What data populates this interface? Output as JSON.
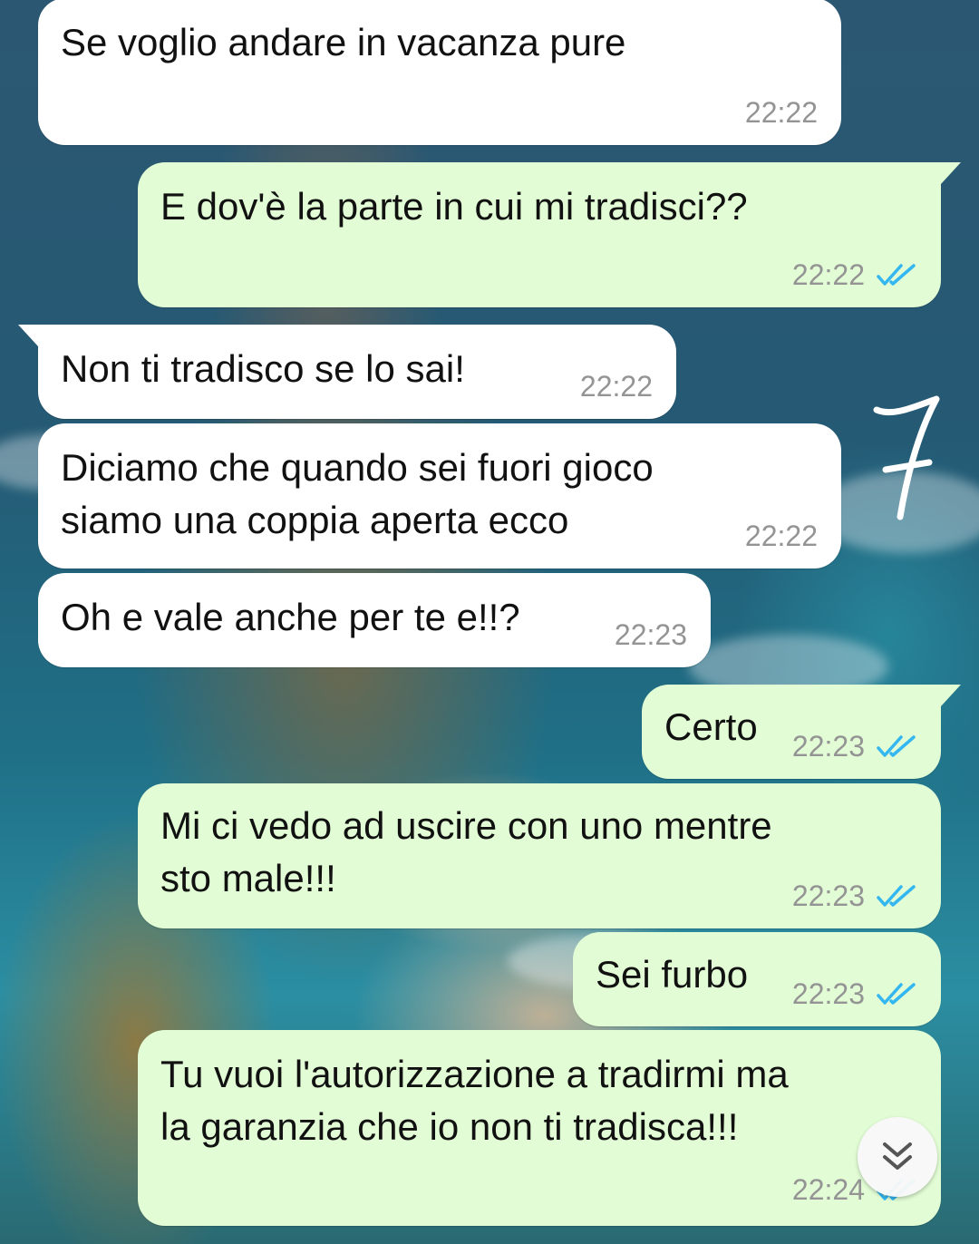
{
  "chat": {
    "messages": [
      {
        "direction": "in",
        "text": "Se voglio andare in vacanza pure",
        "time": "22:22"
      },
      {
        "direction": "out",
        "text": "E dov'è la parte in cui mi tradisci??",
        "time": "22:22",
        "status": "read"
      },
      {
        "direction": "in",
        "text": "Non ti tradisco se lo sai!",
        "time": "22:22"
      },
      {
        "direction": "in",
        "text": "Diciamo che quando sei fuori gioco\nsiamo una coppia aperta ecco",
        "time": "22:22"
      },
      {
        "direction": "in",
        "text": "Oh e vale anche per te e!!?",
        "time": "22:23"
      },
      {
        "direction": "out",
        "text": "Certo",
        "time": "22:23",
        "status": "read"
      },
      {
        "direction": "out",
        "text": "Mi ci vedo ad uscire con uno mentre\nsto male!!!",
        "time": "22:23",
        "status": "read"
      },
      {
        "direction": "out",
        "text": "Sei furbo",
        "time": "22:23",
        "status": "read"
      },
      {
        "direction": "out",
        "text": "Tu vuoi l'autorizzazione a tradirmi ma\nla garanzia che io non ti tradisca!!!",
        "time": "22:24",
        "status": "read"
      }
    ]
  },
  "icons": {
    "read_receipt": "double-check-icon",
    "scroll_down": "chevron-double-down-icon",
    "doodle": "seven-doodle-icon"
  },
  "colors": {
    "incoming_bubble": "#ffffff",
    "outgoing_bubble": "#e2fdd5",
    "timestamp": "#949494",
    "read_tick": "#34b7f1"
  }
}
